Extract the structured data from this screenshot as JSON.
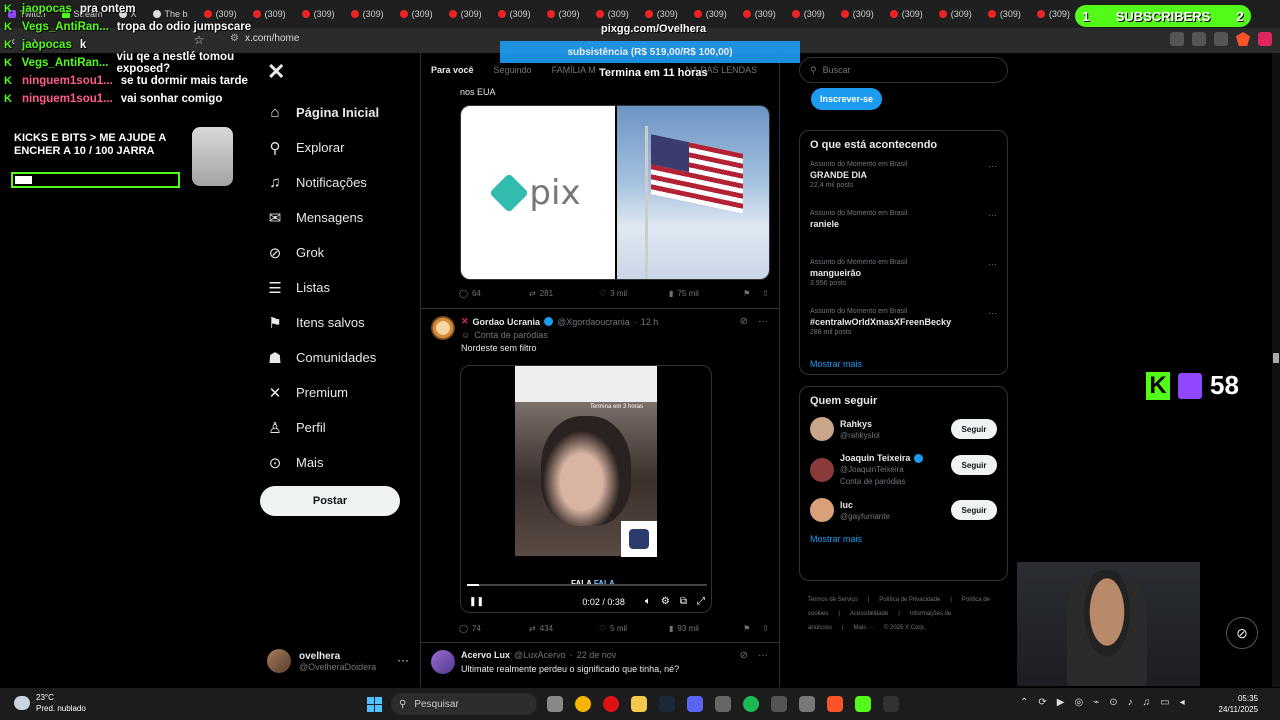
{
  "browser": {
    "tabs": [
      {
        "label": "Twitch",
        "icon": "twitch-icon"
      },
      {
        "label": "Stream",
        "icon": "kick-icon"
      },
      {
        "label": "X",
        "icon": "x-icon"
      },
      {
        "label": "The b",
        "icon": "site-icon"
      },
      {
        "label": "(309)",
        "icon": "youtube-icon"
      },
      {
        "label": "(309)",
        "icon": "youtube-icon"
      },
      {
        "label": "(309)",
        "icon": "youtube-icon"
      },
      {
        "label": "(309)",
        "icon": "youtube-icon"
      },
      {
        "label": "(309)",
        "icon": "youtube-icon"
      },
      {
        "label": "(309)",
        "icon": "youtube-icon"
      },
      {
        "label": "(309)",
        "icon": "youtube-icon"
      },
      {
        "label": "(309)",
        "icon": "youtube-icon"
      },
      {
        "label": "(309)",
        "icon": "youtube-icon"
      },
      {
        "label": "(309)",
        "icon": "youtube-icon"
      },
      {
        "label": "(309)",
        "icon": "youtube-icon"
      },
      {
        "label": "(309)",
        "icon": "youtube-icon"
      },
      {
        "label": "(309)",
        "icon": "youtube-icon"
      },
      {
        "label": "(309)",
        "icon": "youtube-icon"
      },
      {
        "label": "(309)",
        "icon": "youtube-icon"
      },
      {
        "label": "(309)",
        "icon": "youtube-icon"
      },
      {
        "label": "(309)",
        "icon": "youtube-icon"
      },
      {
        "label": "(309)",
        "icon": "youtube-icon"
      },
      {
        "label": "(309)",
        "icon": "youtube-icon"
      }
    ],
    "url": "x.com/home"
  },
  "overlay": {
    "chat": [
      {
        "user": "jaopocas",
        "user_color": "#53fc18",
        "msg": "pra ontem"
      },
      {
        "user": "Vegs_AntiRan...",
        "user_color": "#53fc18",
        "msg": "tropa do odio jumpscare"
      },
      {
        "user": "jaopocas",
        "user_color": "#53fc18",
        "msg": "k"
      },
      {
        "user": "Vegs_AntiRan...",
        "user_color": "#53fc18",
        "msg": "viu qe a nestlé tomou exposed?"
      },
      {
        "user": "ninguem1sou1...",
        "user_color": "#ff5c8a",
        "msg": "se tu dormir mais tarde"
      },
      {
        "user": "ninguem1sou1...",
        "user_color": "#ff5c8a",
        "msg": "vai sonhar comigo"
      }
    ],
    "kicks_goal": "KICKS E BITS > ME AJUDE A ENCHER A 10  / 100 JARRA",
    "kicks_progress": 0.1,
    "subs_left": "1",
    "subs_label": "SUBSCRIBERS",
    "subs_right": "2",
    "pix_url": "pixgg.com/Ovelhera",
    "sub_banner": "subsistência (R$ 519,00/R$ 100,00)",
    "ends_in": "Termina em 11 horas",
    "viewer_count": "58"
  },
  "nav": {
    "items": [
      {
        "label": "Página Inicial",
        "icon": "home-icon",
        "glyph": "⌂",
        "active": true
      },
      {
        "label": "Explorar",
        "icon": "search-icon",
        "glyph": "⚲"
      },
      {
        "label": "Notificações",
        "icon": "bell-icon",
        "glyph": "♫"
      },
      {
        "label": "Mensagens",
        "icon": "mail-icon",
        "glyph": "✉"
      },
      {
        "label": "Grok",
        "icon": "grok-icon",
        "glyph": "⊘"
      },
      {
        "label": "Listas",
        "icon": "list-icon",
        "glyph": "☰"
      },
      {
        "label": "Itens salvos",
        "icon": "bookmark-icon",
        "glyph": "⚑"
      },
      {
        "label": "Comunidades",
        "icon": "people-icon",
        "glyph": "☗"
      },
      {
        "label": "Premium",
        "icon": "x-premium-icon",
        "glyph": "✕"
      },
      {
        "label": "Perfil",
        "icon": "profile-icon",
        "glyph": "♙"
      },
      {
        "label": "Mais",
        "icon": "more-circle-icon",
        "glyph": "⊙"
      }
    ],
    "post_label": "Postar",
    "profile_name": "ovelhera",
    "profile_handle": "@OvelheraDoidera"
  },
  "feed": {
    "tabs": [
      "Para você",
      "Seguindo",
      "FAMÍLIA M",
      "NA DAS LENDAS"
    ],
    "tweet1": {
      "text": "nos EUA",
      "replies": "64",
      "reposts": "281",
      "likes": "3 mil",
      "views": "75 mil"
    },
    "tweet2": {
      "name": "Gordao Ucrania",
      "handle": "@Xgordaoucrania",
      "time": "12 h",
      "label": "Conta de paródias",
      "text": "Nordeste sem filtro",
      "video_top_label": "Termina em 3 horas",
      "caption_a": "FALA",
      "caption_b": "FALA",
      "video_time": "0:02 / 0:38",
      "video_progress": 0.05,
      "replies": "74",
      "reposts": "434",
      "likes": "5 mil",
      "views": "93 mil"
    },
    "tweet3": {
      "name": "Acervo Lux",
      "handle": "@LuxAcervo",
      "time": "22 de nov",
      "text": "Ultimate realmente perdeu o significado que tinha, né?"
    }
  },
  "right": {
    "search_placeholder": "Buscar",
    "subscribe_label": "Inscrever-se",
    "trends_title": "O que está acontecendo",
    "trends": [
      {
        "category": "Assunto do Momento em Brasil",
        "name": "GRANDE DIA",
        "count": "22,4 mil posts"
      },
      {
        "category": "Assunto do Momento em Brasil",
        "name": "raniele",
        "count": ""
      },
      {
        "category": "Assunto do Momento em Brasil",
        "name": "mangueirão",
        "count": "3.956 posts"
      },
      {
        "category": "Assunto do Momento em Brasil",
        "name": "#centralwOrldXmasXFreenBecky",
        "count": "288 mil posts"
      }
    ],
    "show_more": "Mostrar mais",
    "follow_title": "Quem seguir",
    "follow": [
      {
        "name": "Rahkys",
        "handle": "@rahkyslol",
        "sub": "",
        "verified": false,
        "avatar": "#c9a58a"
      },
      {
        "name": "Joaquin Teixeira",
        "handle": "@JoaquinTeixeira",
        "sub": "Conta de paródias",
        "verified": true,
        "avatar": "#8a3a3a"
      },
      {
        "name": "luc",
        "handle": "@gayfumante",
        "sub": "",
        "verified": false,
        "avatar": "#d9a07a"
      }
    ],
    "follow_btn": "Seguir",
    "footer": [
      "Termos de Serviço",
      "|",
      "Política de Privacidade",
      "|",
      "Política de cookies",
      "|",
      "Acessibilidade",
      "|",
      "Informações de anúncios",
      "|",
      "Mais ···",
      "© 2025 X Corp."
    ]
  },
  "taskbar": {
    "temp": "23°C",
    "weather": "Pred. nublado",
    "search": "Pesquisar",
    "time": "05:35",
    "date": "24/11/2025"
  }
}
